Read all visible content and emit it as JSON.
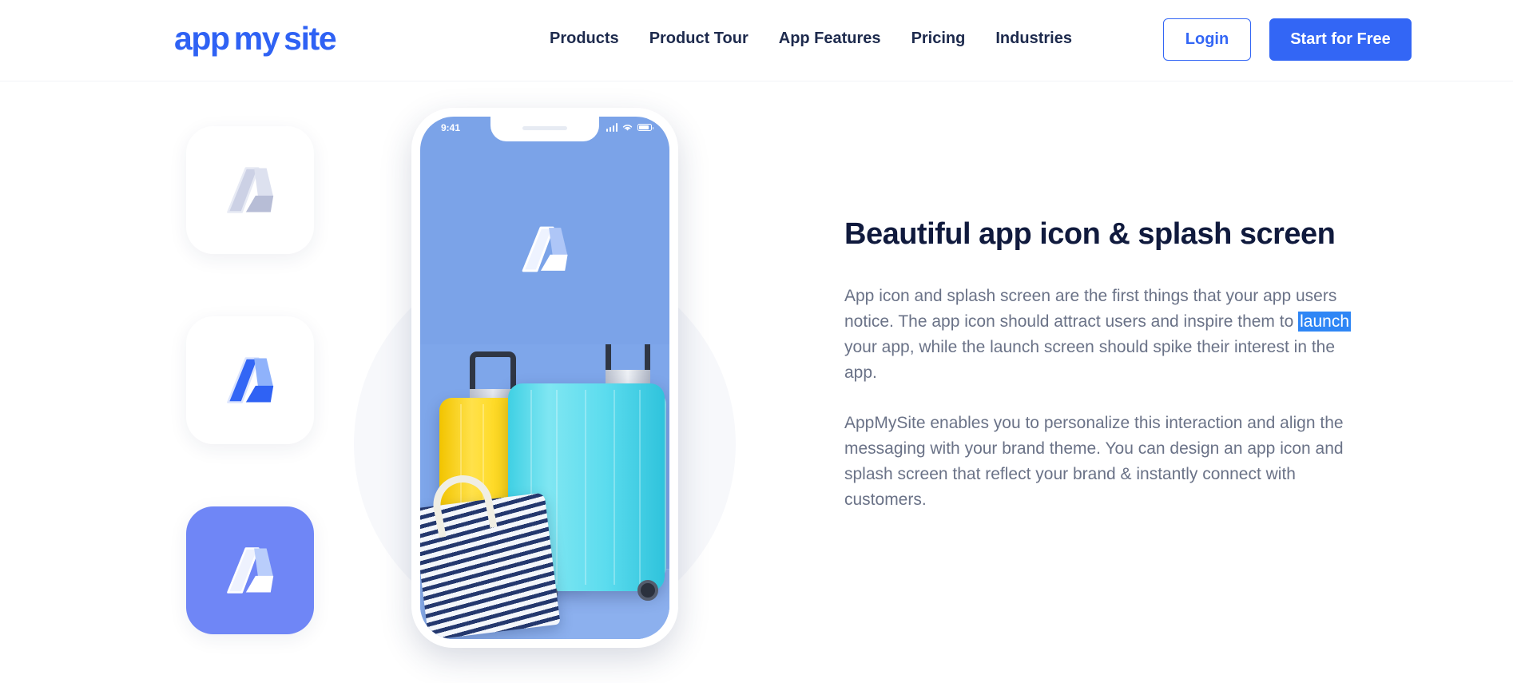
{
  "header": {
    "logo": {
      "part1": "app",
      "part2": "my",
      "part3": "site"
    },
    "nav": [
      {
        "label": "Products"
      },
      {
        "label": "Product Tour"
      },
      {
        "label": "App Features"
      },
      {
        "label": "Pricing"
      },
      {
        "label": "Industries"
      }
    ],
    "login_label": "Login",
    "cta_label": "Start for Free"
  },
  "hero": {
    "icon_tiles": [
      {
        "name": "app-icon-tile-grey",
        "background": "#ffffff",
        "logo_color": "#c6cbe0"
      },
      {
        "name": "app-icon-tile-blue",
        "background": "#ffffff",
        "logo_color": "#3366f5"
      },
      {
        "name": "app-icon-tile-filled",
        "background": "#6f86f6",
        "logo_color": "#ffffff"
      }
    ],
    "phone": {
      "status_time": "9:41",
      "status_icons": [
        "signal-icon",
        "wifi-icon",
        "battery-icon"
      ],
      "splash_background": "#7ba3e8",
      "splash_logo": "appmysite-logo-white",
      "photo_alt": "travel-luggage-photo"
    }
  },
  "copy": {
    "heading": "Beautiful app icon & splash screen",
    "paragraph1_before": "App icon and splash screen are the first things that your app users notice. The app icon should attract users and inspire them to ",
    "paragraph1_selected": "launch",
    "paragraph1_after": " your app, while the launch screen should spike their interest in the app.",
    "paragraph2": "AppMySite enables you to personalize this interaction and align the messaging with your brand theme. You can design an app icon and splash screen that reflect your brand & instantly connect with customers."
  },
  "colors": {
    "brand_blue": "#3366f5",
    "logo_blue": "#2f62f4",
    "nav_navy": "#1d2a4d",
    "heading_navy": "#101a3d",
    "body_grey": "#6a7287",
    "selection_blue": "#2f86f5",
    "tile_periwinkle": "#6f86f6",
    "splash_blue": "#7ba3e8"
  }
}
